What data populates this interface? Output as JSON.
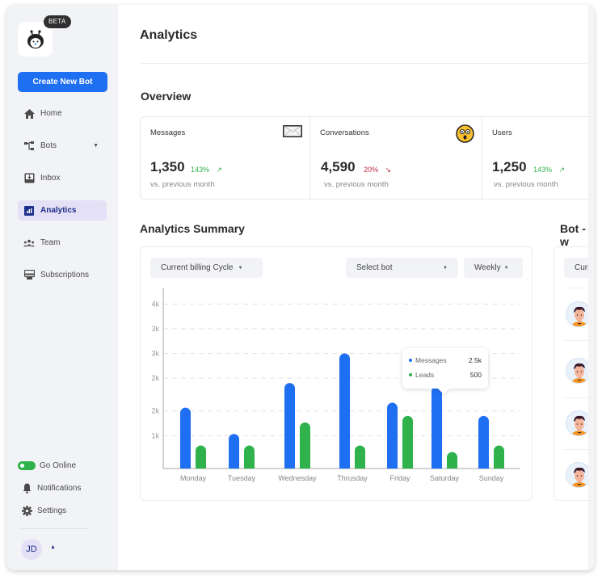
{
  "sidebar": {
    "beta_badge": "BETA",
    "create_button": "Create New Bot",
    "nav": [
      {
        "label": "Home",
        "icon": "home-icon",
        "active": false
      },
      {
        "label": "Bots",
        "icon": "flow-icon",
        "active": false,
        "has_caret": true
      },
      {
        "label": "Inbox",
        "icon": "inbox-icon",
        "active": false
      },
      {
        "label": "Analytics",
        "icon": "analytics-icon",
        "active": true
      },
      {
        "label": "Team",
        "icon": "team-icon",
        "active": false
      },
      {
        "label": "Subscriptions",
        "icon": "subscriptions-icon",
        "active": false
      }
    ],
    "bottom": {
      "go_online": "Go Online",
      "notifications": "Notifications",
      "settings": "Settings"
    },
    "user_initials": "JD",
    "colors": {
      "accent": "#1f6ff2",
      "active_bg": "#e4e0f5",
      "online": "#2fb24c"
    }
  },
  "header": {
    "title": "Analytics"
  },
  "overview": {
    "title": "Overview",
    "stats": [
      {
        "label": "Messages",
        "value": "1,350",
        "change": "143%",
        "direction": "up",
        "sub": "vs. previous month",
        "icon": "envelope-icon"
      },
      {
        "label": "Conversations",
        "value": "4,590",
        "change": "20%",
        "direction": "down",
        "sub": "vs. previous month",
        "icon": "astonished-face-icon"
      },
      {
        "label": "Users",
        "value": "1,250",
        "change": "143%",
        "direction": "up",
        "sub": "vs. previous month",
        "icon": ""
      }
    ]
  },
  "summary": {
    "title": "Analytics Summary",
    "billing_dropdown": "Current billing Cycle",
    "bot_dropdown": "Select bot",
    "period_dropdown": "Weekly",
    "tooltip": {
      "rows": [
        {
          "label": "Messages",
          "value": "2.5k",
          "color": "#1f6ff2"
        },
        {
          "label": "Leads",
          "value": "500",
          "color": "#2fb24c"
        }
      ]
    }
  },
  "bot_panel": {
    "title": "Bot - w",
    "dropdown": "Curre",
    "avatar_count": 4
  },
  "chart_data": {
    "type": "bar",
    "title": "Analytics Summary",
    "xlabel": "",
    "ylabel": "",
    "categories": [
      "Monday",
      "Tuesday",
      "Wednesday",
      "Thrusday",
      "Friday",
      "Saturday",
      "Sunday"
    ],
    "series": [
      {
        "name": "Messages",
        "color": "#1f6ff2",
        "values": [
          1850,
          1050,
          2600,
          3500,
          2000,
          2500,
          1600
        ]
      },
      {
        "name": "Leads",
        "color": "#2fb24c",
        "values": [
          700,
          700,
          1400,
          700,
          1600,
          500,
          700
        ]
      }
    ],
    "y_ticks": [
      1000,
      1750,
      2750,
      3500,
      4250,
      5000
    ],
    "y_tick_labels": [
      "1k",
      "2k",
      "2k",
      "3k",
      "3k",
      "4k"
    ],
    "ylim": [
      0,
      5500
    ],
    "grid": true,
    "highlighted_category": "Saturday"
  }
}
